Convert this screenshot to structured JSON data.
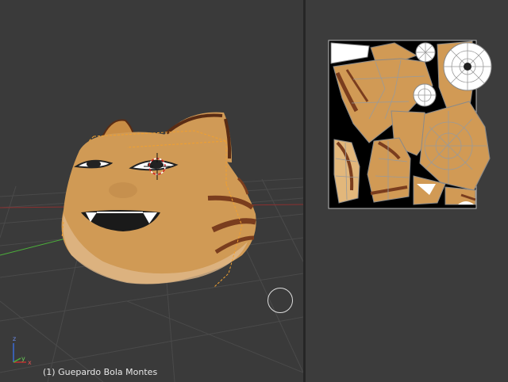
{
  "viewport": {
    "object_label": "(1) Guepardo Bola Montes",
    "axis_labels": {
      "z": "z",
      "y": "y",
      "x": "x"
    }
  },
  "colors": {
    "background": "#3a3a3a",
    "fur": "#d19a55",
    "fur_light": "#e2b77b",
    "stripe": "#7a3d1e",
    "selection_outline": "#f0a030",
    "x_axis": "#c03030",
    "y_axis": "#4caf3a",
    "z_axis": "#3a6ad6",
    "uv_wire": "#9a9a9a"
  }
}
